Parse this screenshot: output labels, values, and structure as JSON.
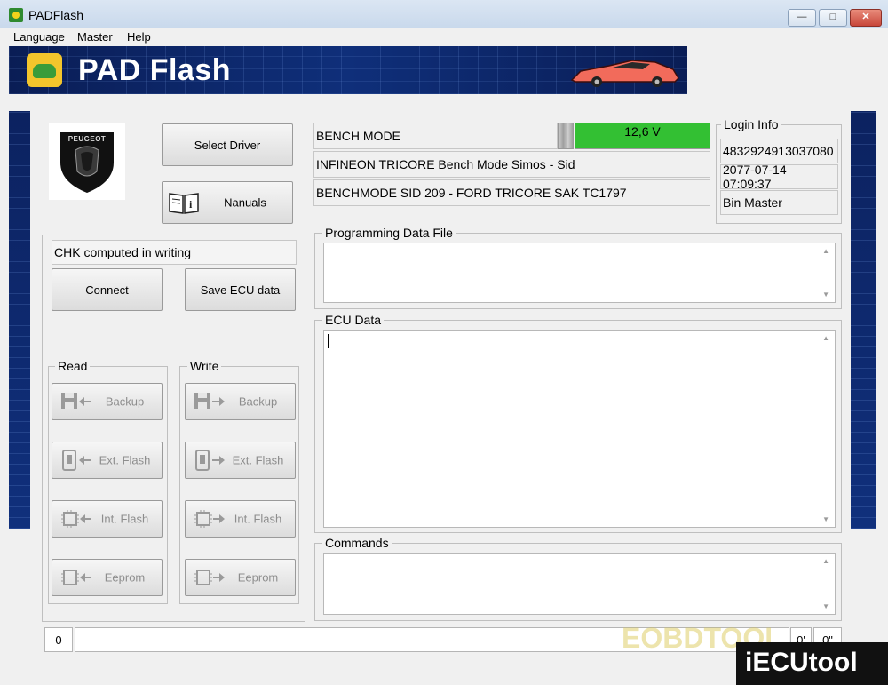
{
  "window": {
    "title": "PADFlash",
    "min": "—",
    "max": "□",
    "close": "✕"
  },
  "menu": [
    "Language",
    "Master",
    "Help"
  ],
  "banner": {
    "brand": "PAD Flash"
  },
  "logo": {
    "brand_text": "PEUGEOT"
  },
  "buttons": {
    "select_driver": "Select Driver",
    "manuals": "Nanuals",
    "connect": "Connect",
    "save_ecu": "Save ECU data"
  },
  "status": {
    "chk": "CHK computed in writing"
  },
  "mode": {
    "bench": "BENCH MODE",
    "voltage": "12,6 V",
    "voltage_level": 1.0,
    "voltage_color": "#33c033",
    "ecu_line1": "INFINEON TRICORE Bench Mode Simos - Sid",
    "ecu_line2": "BENCHMODE SID 209 - FORD TRICORE SAK TC1797"
  },
  "login": {
    "label": "Login Info",
    "id": "4832924913037080",
    "date": "2077-07-14 07:09:37",
    "role": "Bin Master"
  },
  "read": {
    "label": "Read",
    "items": [
      "Backup",
      "Ext. Flash",
      "Int. Flash",
      "Eeprom"
    ]
  },
  "write": {
    "label": "Write",
    "items": [
      "Backup",
      "Ext. Flash",
      "Int. Flash",
      "Eeprom"
    ]
  },
  "panels": {
    "programming": "Programming Data File",
    "ecu_data": "ECU Data",
    "commands": "Commands"
  },
  "statusbar": {
    "count": "0",
    "time1": "0'",
    "time2": "0\""
  },
  "watermarks": {
    "eobd": "EOBDTOOL",
    "iecu": "iECUtool"
  }
}
